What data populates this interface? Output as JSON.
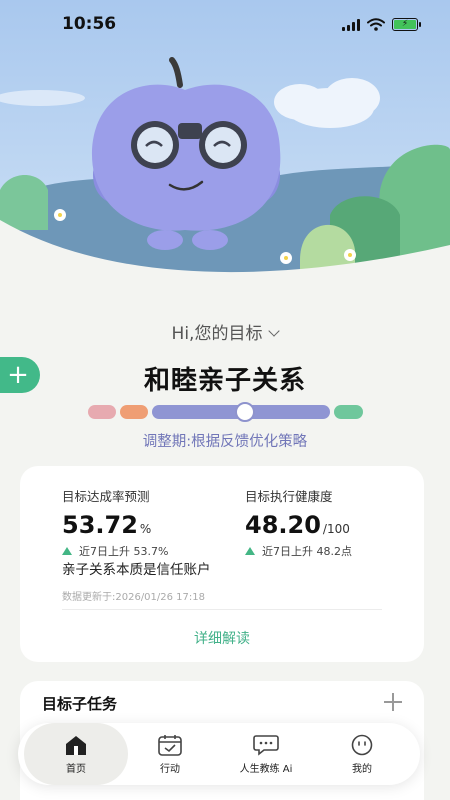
{
  "status_bar": {
    "time": "10:56",
    "icons": [
      "signal-icon",
      "wifi-icon",
      "battery-charging-icon"
    ]
  },
  "hero": {
    "illustration": "purple-apple-mascot-with-binoculars"
  },
  "goal": {
    "greeting": "Hi,您的目标",
    "title": "和睦亲子关系",
    "phase_label": "调整期:根据反馈优化策略",
    "phase_progress": 0.57,
    "phase_colors": [
      "#e7aab0",
      "#ef9e74",
      "#8f95d3",
      "#6fc79c"
    ]
  },
  "stats": {
    "left": {
      "label": "目标达成率预测",
      "value": "53.72",
      "unit": "%",
      "trend": "近7日上升 53.7%"
    },
    "right": {
      "label": "目标执行健康度",
      "value": "48.20",
      "unit": "/100",
      "trend": "近7日上升 48.2点"
    },
    "insight": "亲子关系本质是信任账户",
    "updated": "数据更新于:2026/01/26 17:18",
    "detail_link": "详细解读"
  },
  "subtasks": {
    "title": "目标子任务"
  },
  "nav": {
    "items": [
      {
        "label": "首页",
        "icon": "home-icon"
      },
      {
        "label": "行动",
        "icon": "calendar-check-icon"
      },
      {
        "label": "人生教练 Ai",
        "icon": "chat-bubble-icon"
      },
      {
        "label": "我的",
        "icon": "smiley-face-icon"
      }
    ]
  },
  "colors": {
    "accent_green": "#42b989",
    "accent_purple": "#7176b8",
    "sky": "#b7d4f2"
  }
}
